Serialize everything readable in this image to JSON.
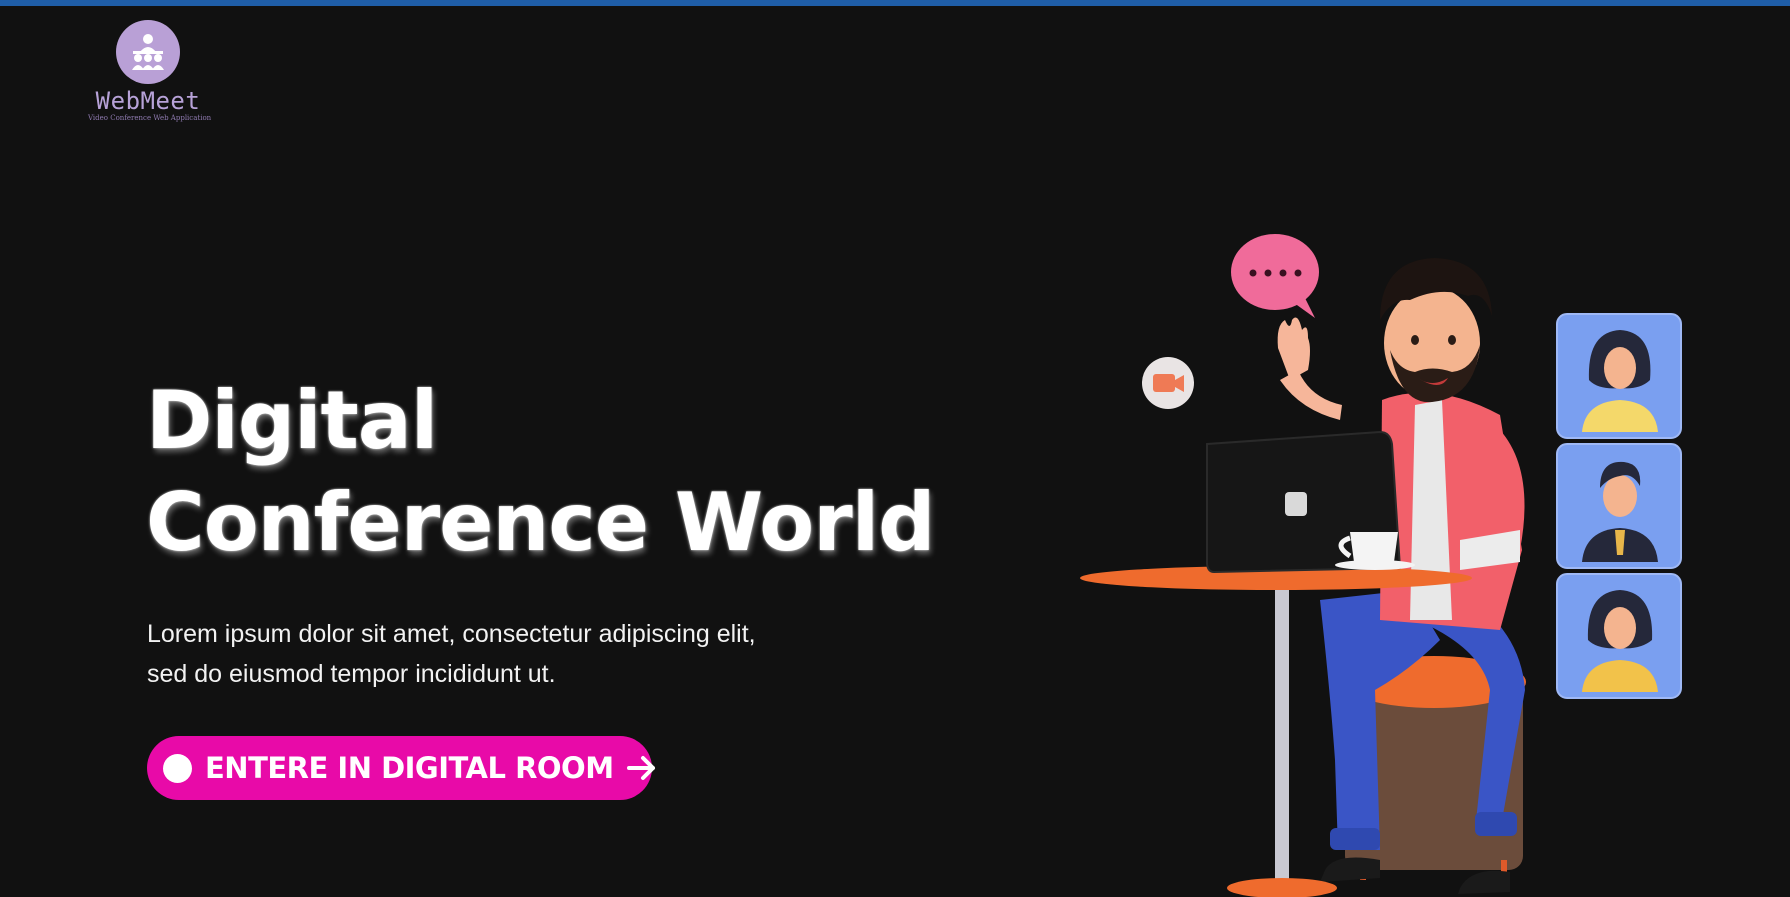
{
  "brand": {
    "name": "WebMeet",
    "tagline": "Video Conference Web Application",
    "logo_icon": "group-meeting-icon"
  },
  "hero": {
    "title_line1": "Digital",
    "title_line2": "Conference World",
    "description_line1": "Lorem ipsum dolor sit amet, consectetur adipiscing elit,",
    "description_line2": "sed do eiusmod tempor incididunt ut.",
    "cta_label": "ENTERE IN DIGITAL ROOM",
    "cta_icon": "arrow-right-icon"
  },
  "illustration": {
    "icons": [
      "chat-bubble-icon",
      "video-camera-icon",
      "laptop-icon",
      "coffee-cup-icon",
      "participant-avatar-icon"
    ]
  },
  "colors": {
    "background": "#111111",
    "top_strip": "#1f5ea8",
    "accent": "#e80aa8",
    "logo": "#b9a0d6",
    "avatar_tile": "#7a9ff0"
  }
}
